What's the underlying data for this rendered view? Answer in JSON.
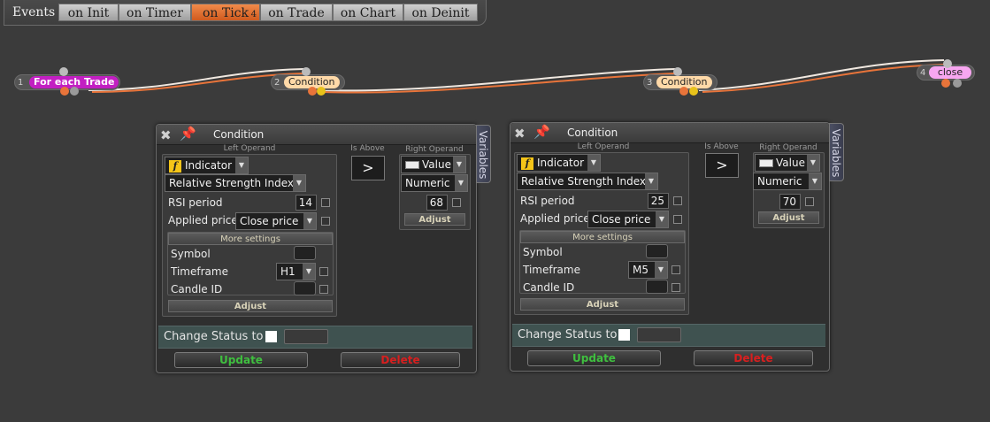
{
  "events": {
    "label": "Events",
    "tabs": [
      {
        "label": "on Init"
      },
      {
        "label": "on Timer"
      },
      {
        "label": "on Tick",
        "badge": "4"
      },
      {
        "label": "on Trade"
      },
      {
        "label": "on Chart"
      },
      {
        "label": "on Deinit"
      }
    ]
  },
  "flow": {
    "nodes": [
      {
        "num": "1",
        "label": "For each Trade"
      },
      {
        "num": "2",
        "label": "Condition"
      },
      {
        "num": "3",
        "label": "Condition"
      },
      {
        "num": "4",
        "label": "close"
      }
    ]
  },
  "panels": [
    {
      "title": "Condition",
      "variables_tab": "Variables",
      "left_operand_label": "Left Operand",
      "operator_label": "Is Above",
      "operator_symbol": ">",
      "right_operand_label": "Right Operand",
      "left_type": "Indicator",
      "indicator": "Relative Strength Index",
      "rsi_period_label": "RSI period",
      "rsi_period_value": "14",
      "applied_price_label": "Applied price",
      "applied_price_value": "Close price",
      "more_settings_label": "More settings",
      "symbol_label": "Symbol",
      "timeframe_label": "Timeframe",
      "timeframe_value": "H1",
      "candle_label": "Candle ID",
      "adjust_label": "Adjust",
      "right_type": "Value",
      "right_format": "Numeric",
      "right_value": "68",
      "right_adjust_label": "Adjust",
      "change_status_label": "Change Status to",
      "update_label": "Update",
      "delete_label": "Delete"
    },
    {
      "title": "Condition",
      "variables_tab": "Variables",
      "left_operand_label": "Left Operand",
      "operator_label": "Is Above",
      "operator_symbol": ">",
      "right_operand_label": "Right Operand",
      "left_type": "Indicator",
      "indicator": "Relative Strength Index",
      "rsi_period_label": "RSI period",
      "rsi_period_value": "25",
      "applied_price_label": "Applied price",
      "applied_price_value": "Close price",
      "more_settings_label": "More settings",
      "symbol_label": "Symbol",
      "timeframe_label": "Timeframe",
      "timeframe_value": "M5",
      "candle_label": "Candle ID",
      "adjust_label": "Adjust",
      "right_type": "Value",
      "right_format": "Numeric",
      "right_value": "70",
      "right_adjust_label": "Adjust",
      "change_status_label": "Change Status to",
      "update_label": "Update",
      "delete_label": "Delete"
    }
  ],
  "colors": {
    "active_tab": "#e8743a",
    "node_magenta": "#c21fc2",
    "node_peach": "#ffd9a8",
    "node_pink": "#f7a6f0",
    "update_text": "#3fbf3f",
    "delete_text": "#d81f1f"
  }
}
